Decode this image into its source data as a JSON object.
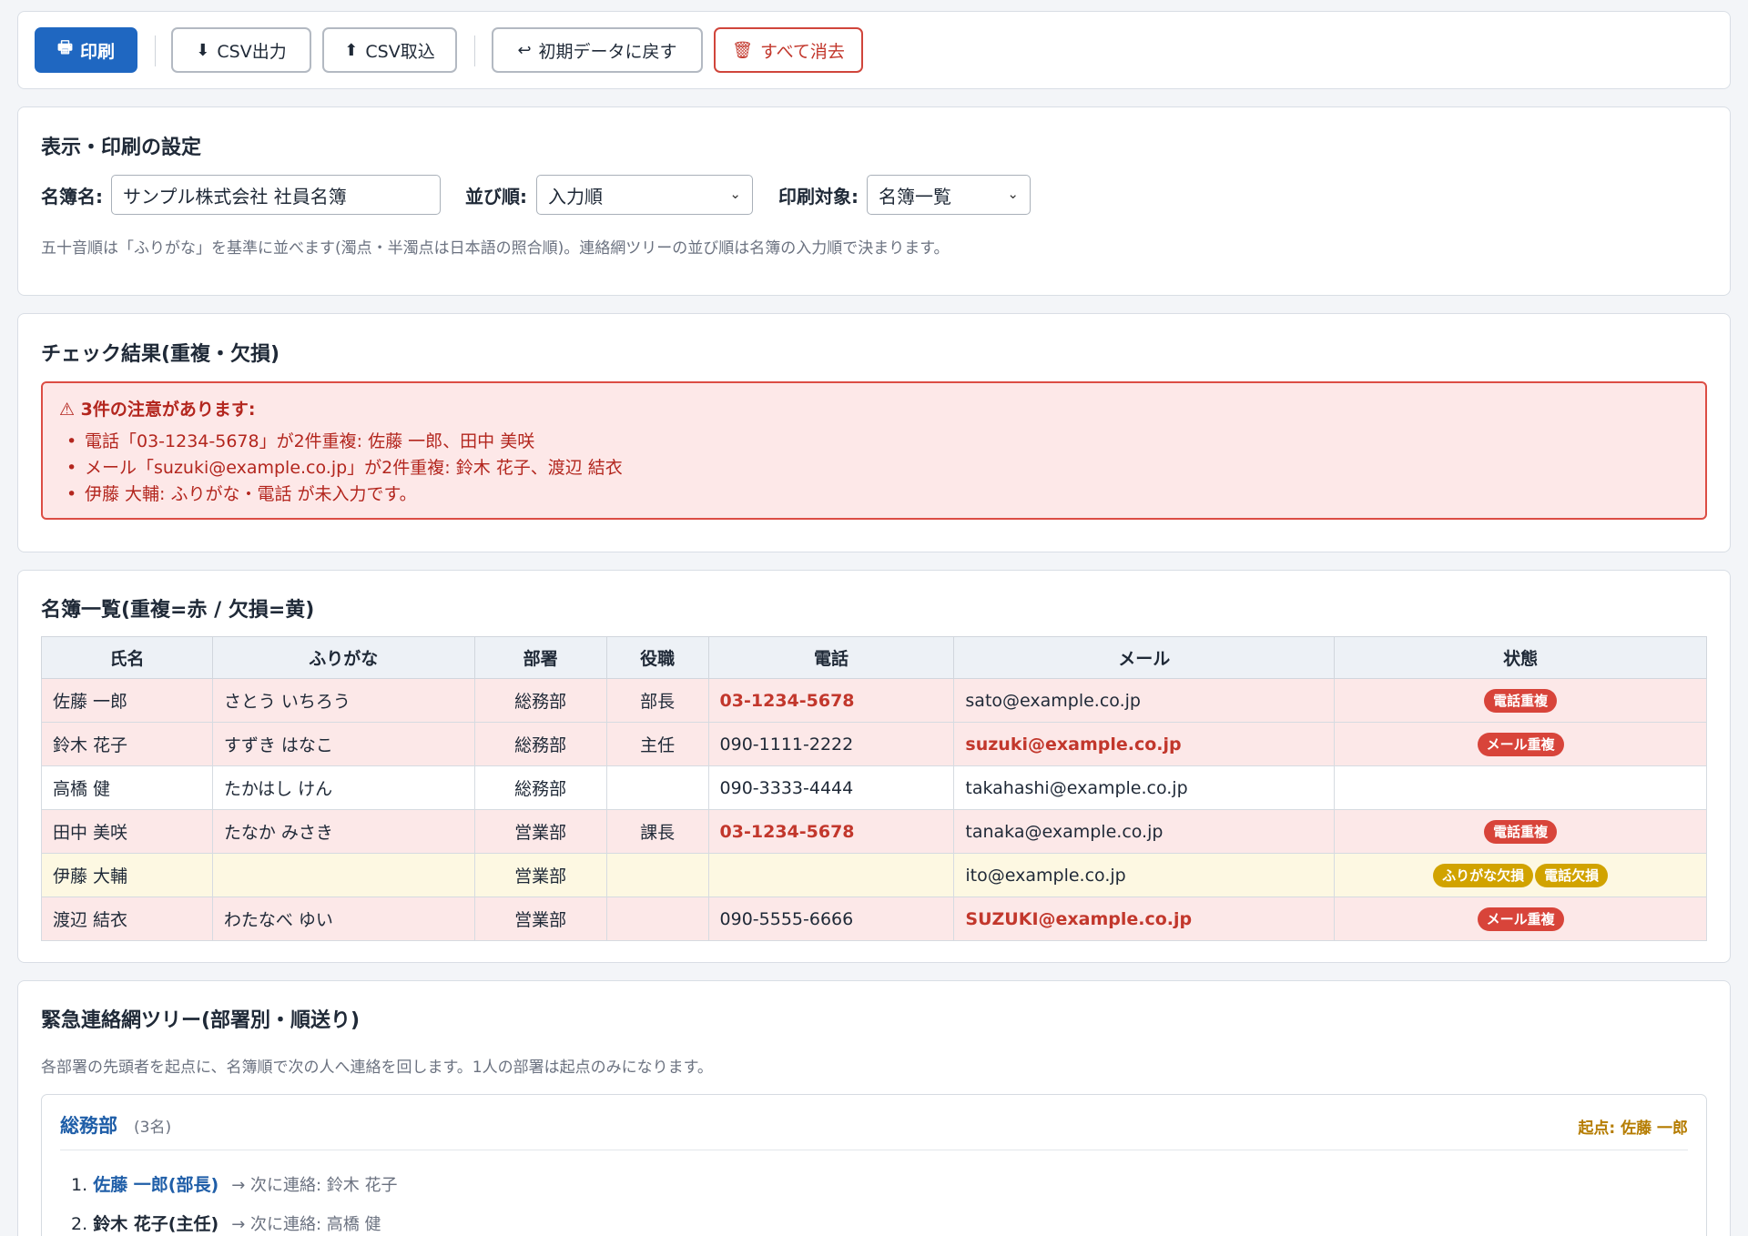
{
  "toolbar": {
    "print": "印刷",
    "csv_export": "CSV出力",
    "csv_import": "CSV取込",
    "reset": "初期データに戻す",
    "clear_all": "すべて消去"
  },
  "settings": {
    "title": "表示・印刷の設定",
    "roster_name_label": "名簿名:",
    "roster_name_value": "サンプル株式会社 社員名簿",
    "sort_label": "並び順:",
    "sort_value": "入力順",
    "print_target_label": "印刷対象:",
    "print_target_value": "名簿一覧",
    "note": "五十音順は「ふりがな」を基準に並べます(濁点・半濁点は日本語の照合順)。連絡網ツリーの並び順は名簿の入力順で決まります。"
  },
  "check": {
    "title": "チェック結果(重複・欠損)",
    "alert_title": "3件の注意があります:",
    "items": [
      "電話「03-1234-5678」が2件重複: 佐藤 一郎、田中 美咲",
      "メール「suzuki@example.co.jp」が2件重複: 鈴木 花子、渡辺 結衣",
      "伊藤 大輔: ふりがな・電話 が未入力です。"
    ]
  },
  "roster": {
    "title": "名簿一覧(重複=赤 / 欠損=黄)",
    "headers": [
      "氏名",
      "ふりがな",
      "部署",
      "役職",
      "電話",
      "メール",
      "状態"
    ],
    "rows": [
      {
        "name": "佐藤 一郎",
        "kana": "さとう いちろう",
        "dept": "総務部",
        "role": "部長",
        "phone": "03-1234-5678",
        "email": "sato@example.co.jp",
        "status": [
          "電話重複"
        ]
      },
      {
        "name": "鈴木 花子",
        "kana": "すずき はなこ",
        "dept": "総務部",
        "role": "主任",
        "phone": "090-1111-2222",
        "email": "suzuki@example.co.jp",
        "status": [
          "メール重複"
        ]
      },
      {
        "name": "高橋 健",
        "kana": "たかはし けん",
        "dept": "総務部",
        "role": "",
        "phone": "090-3333-4444",
        "email": "takahashi@example.co.jp",
        "status": []
      },
      {
        "name": "田中 美咲",
        "kana": "たなか みさき",
        "dept": "営業部",
        "role": "課長",
        "phone": "03-1234-5678",
        "email": "tanaka@example.co.jp",
        "status": [
          "電話重複"
        ]
      },
      {
        "name": "伊藤 大輔",
        "kana": "",
        "dept": "営業部",
        "role": "",
        "phone": "",
        "email": "ito@example.co.jp",
        "status": [
          "ふりがな欠損",
          "電話欠損"
        ]
      },
      {
        "name": "渡辺 結衣",
        "kana": "わたなべ ゆい",
        "dept": "営業部",
        "role": "",
        "phone": "090-5555-6666",
        "email": "SUZUKI@example.co.jp",
        "status": [
          "メール重複"
        ]
      }
    ]
  },
  "tree": {
    "title": "緊急連絡網ツリー(部署別・順送り)",
    "note": "各部署の先頭者を起点に、名簿順で次の人へ連絡を回します。1人の部署は起点のみになります。",
    "dept": "総務部",
    "count": "(3名)",
    "origin": "起点: 佐藤 一郎",
    "items": [
      {
        "no": "1.",
        "name": "佐藤 一郎(部長)",
        "next": "→ 次に連絡: 鈴木 花子"
      },
      {
        "no": "2.",
        "name": "鈴木 花子(主任)",
        "next": "→ 次に連絡: 高橋 健"
      }
    ]
  },
  "colors": {
    "primary": "#1f67c1",
    "danger": "#d0453b",
    "dup_row": "#fce8e8",
    "miss_row": "#fdf8e2",
    "badge_red": "#d8443a",
    "badge_yellow": "#d1a300"
  }
}
